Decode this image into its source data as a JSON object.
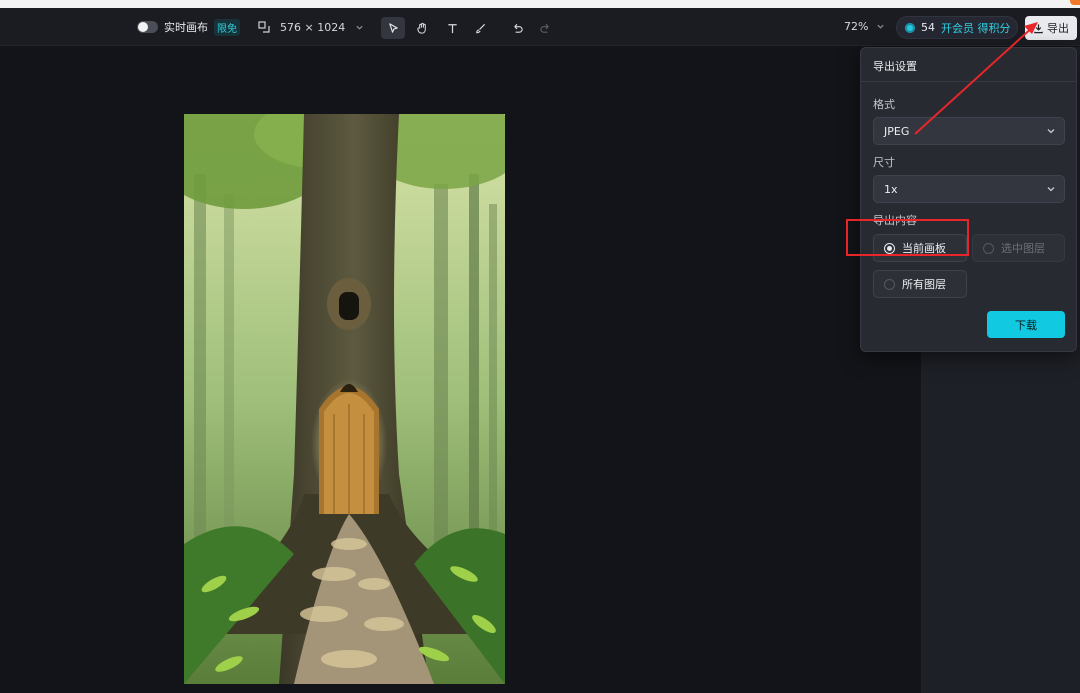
{
  "toolbar": {
    "realtime_label": "实时画布",
    "free_tag": "限免",
    "canvas_size": "576 × 1024",
    "zoom": "72%",
    "credits_count": "54",
    "vip_label": "开会员 得积分",
    "export_label": "导出"
  },
  "icons": {
    "resize": "resize-icon",
    "select": "pointer-icon",
    "hand": "hand-icon",
    "text": "text-icon",
    "brush": "brush-icon",
    "undo": "undo-icon",
    "redo": "redo-icon",
    "download": "download-icon"
  },
  "export_panel": {
    "title": "导出设置",
    "format_label": "格式",
    "format_value": "JPEG",
    "size_label": "尺寸",
    "size_value": "1x",
    "content_label": "导出内容",
    "options": [
      {
        "label": "当前画板",
        "selected": true,
        "disabled": false
      },
      {
        "label": "选中图层",
        "selected": false,
        "disabled": true
      },
      {
        "label": "所有图层",
        "selected": false,
        "disabled": false
      }
    ],
    "download_label": "下载"
  },
  "colors": {
    "accent": "#11c9e0",
    "annotation": "#e8262a",
    "background": "#131419"
  }
}
